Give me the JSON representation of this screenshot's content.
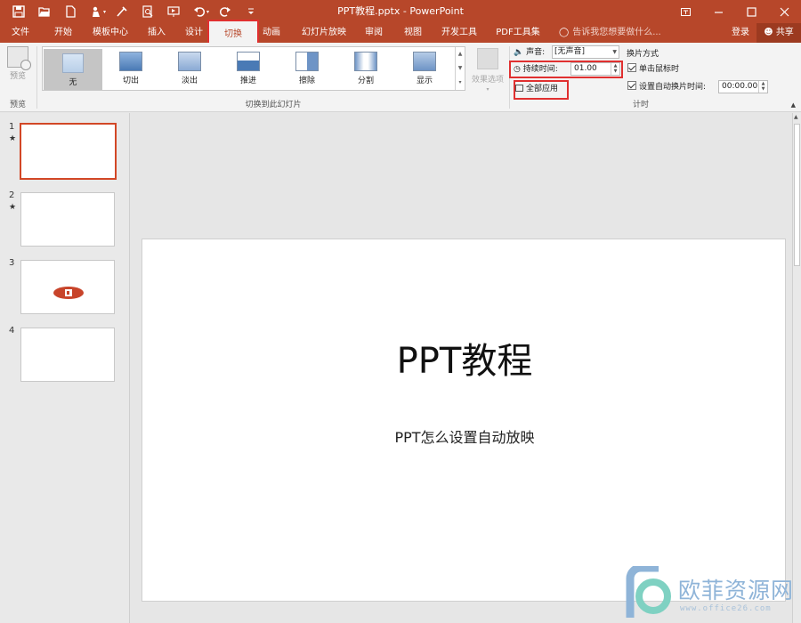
{
  "window": {
    "title": "PPT教程.pptx - PowerPoint",
    "accent_color": "#b7472a",
    "highlight_color": "#e03030"
  },
  "quick_access": [
    "save-icon",
    "open-icon",
    "new-icon",
    "touch-mode-icon",
    "format-painter-icon",
    "print-preview-icon",
    "slideshow-icon",
    "undo-icon",
    "redo-icon",
    "customize-icon"
  ],
  "window_controls": [
    "ribbon-display-icon",
    "minimize-icon",
    "maximize-icon",
    "close-icon"
  ],
  "tabs": [
    "文件",
    "开始",
    "模板中心",
    "插入",
    "设计",
    "切换",
    "动画",
    "幻灯片放映",
    "审阅",
    "视图",
    "开发工具",
    "PDF工具集"
  ],
  "active_tab": "切换",
  "tell_me": "告诉我您想要做什么...",
  "login": "登录",
  "share": "共享",
  "ribbon": {
    "preview": {
      "button": "预览",
      "group": "预览"
    },
    "transitions": {
      "group": "切换到此幻灯片",
      "items": [
        "无",
        "切出",
        "淡出",
        "推进",
        "擦除",
        "分割",
        "显示"
      ],
      "selected": "无",
      "effect_options": "效果选项"
    },
    "timing": {
      "group": "计时",
      "sound_label": "声音:",
      "sound_value": "[无声音]",
      "duration_label": "持续时间:",
      "duration_value": "01.00",
      "apply_all": "全部应用",
      "advance_title": "换片方式",
      "on_click": "单击鼠标时",
      "on_click_checked": true,
      "after_label": "设置自动换片时间:",
      "after_checked": true,
      "after_value": "00:00.00"
    }
  },
  "slides": [
    {
      "number": "1",
      "star": "★",
      "selected": true
    },
    {
      "number": "2",
      "star": "★",
      "selected": false
    },
    {
      "number": "3",
      "star": "",
      "selected": false,
      "has_logo": true
    },
    {
      "number": "4",
      "star": "",
      "selected": false
    }
  ],
  "current_slide": {
    "title": "PPT教程",
    "subtitle": "PPT怎么设置自动放映"
  },
  "watermark": {
    "name": "欧菲资源网",
    "url": "www.office26.com"
  }
}
